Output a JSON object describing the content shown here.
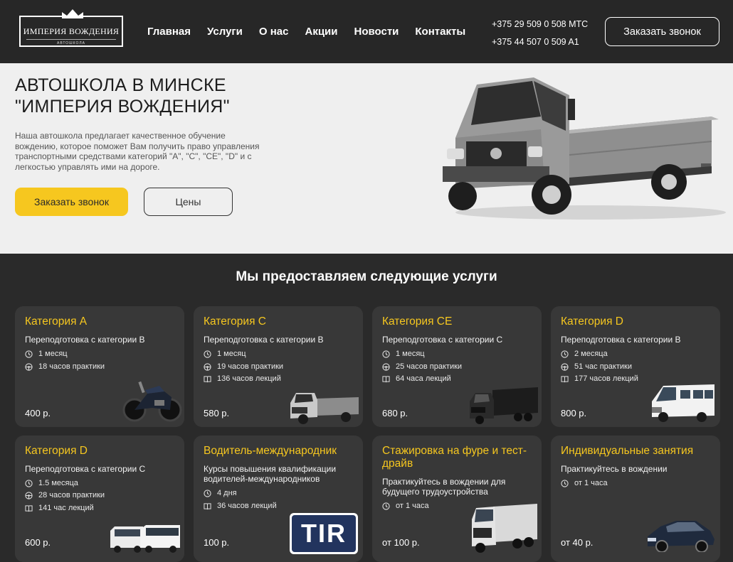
{
  "header": {
    "logo_title": "ИМПЕРИЯ ВОЖДЕНИЯ",
    "logo_sub": "АВТОШКОЛА",
    "nav": [
      "Главная",
      "Услуги",
      "О нас",
      "Акции",
      "Новости",
      "Контакты"
    ],
    "phones": [
      "+375 29 509 0 508 МТС",
      "+375 44 507 0 509 A1"
    ],
    "callback_label": "Заказать звонок"
  },
  "hero": {
    "title_line1": "АВТОШКОЛА В МИНСКЕ",
    "title_line2": "\"ИМПЕРИЯ ВОЖДЕНИЯ\"",
    "text": "Наша автошкола предлагает качественное обучение вождению, которое поможет Вам получить право управления транспортными средствами категорий \"А\", \"С\", \"СЕ\", \"D\" и с легкостью управлять ими на дороге.",
    "callback_label": "Заказать звонок",
    "prices_label": "Цены"
  },
  "services": {
    "title": "Мы предоставляем следующие услуги",
    "cards": [
      {
        "title": "Категория А",
        "subtitle": "Переподготовка с категории В",
        "duration": "1 месяц",
        "practice": "18 часов практики",
        "lectures": "",
        "price": "400 р.",
        "image": "motorcycle"
      },
      {
        "title": "Категория С",
        "subtitle": "Переподготовка с категории В",
        "duration": "1 месяц",
        "practice": "19 часов практики",
        "lectures": "136 часов лекций",
        "price": "580 р.",
        "image": "truck"
      },
      {
        "title": "Категория СЕ",
        "subtitle": "Переподготовка с категории С",
        "duration": "1 месяц",
        "practice": "25 часов практики",
        "lectures": "64 часа лекций",
        "price": "680 р.",
        "image": "semi-truck"
      },
      {
        "title": "Категория D",
        "subtitle": "Переподготовка с категории В",
        "duration": "2 месяца",
        "practice": "51 час практики",
        "lectures": "177 часов лекций",
        "price": "800 р.",
        "image": "van"
      },
      {
        "title": "Категория D",
        "subtitle": "Переподготовка с категории С",
        "duration": "1.5 месяца",
        "practice": "28 часов практики",
        "lectures": "141 час лекций",
        "price": "600 р.",
        "image": "buses"
      },
      {
        "title": "Водитель-международник",
        "subtitle": "Курсы повышения квалификации водителей-международников",
        "duration": "4 дня",
        "practice": "",
        "lectures": "36 часов лекций",
        "price": "100 р.",
        "image": "tir-sign",
        "badge": "TIR"
      },
      {
        "title": "Стажировка на фуре и тест-драйв",
        "subtitle": "Практикуйтесь в вождении для будущего трудоустройства",
        "duration": "от 1 часа",
        "practice": "",
        "lectures": "",
        "price": "от 100 р.",
        "image": "lorry"
      },
      {
        "title": "Индивидуальные занятия",
        "subtitle": "Практикуйтесь в вождении",
        "duration": "от 1 часа",
        "practice": "",
        "lectures": "",
        "price": "от 40 р.",
        "image": "car"
      }
    ]
  },
  "colors": {
    "accent": "#f6c71f",
    "dark": "#2a2a2a",
    "card": "#383838",
    "hero_bg": "#efefef"
  }
}
